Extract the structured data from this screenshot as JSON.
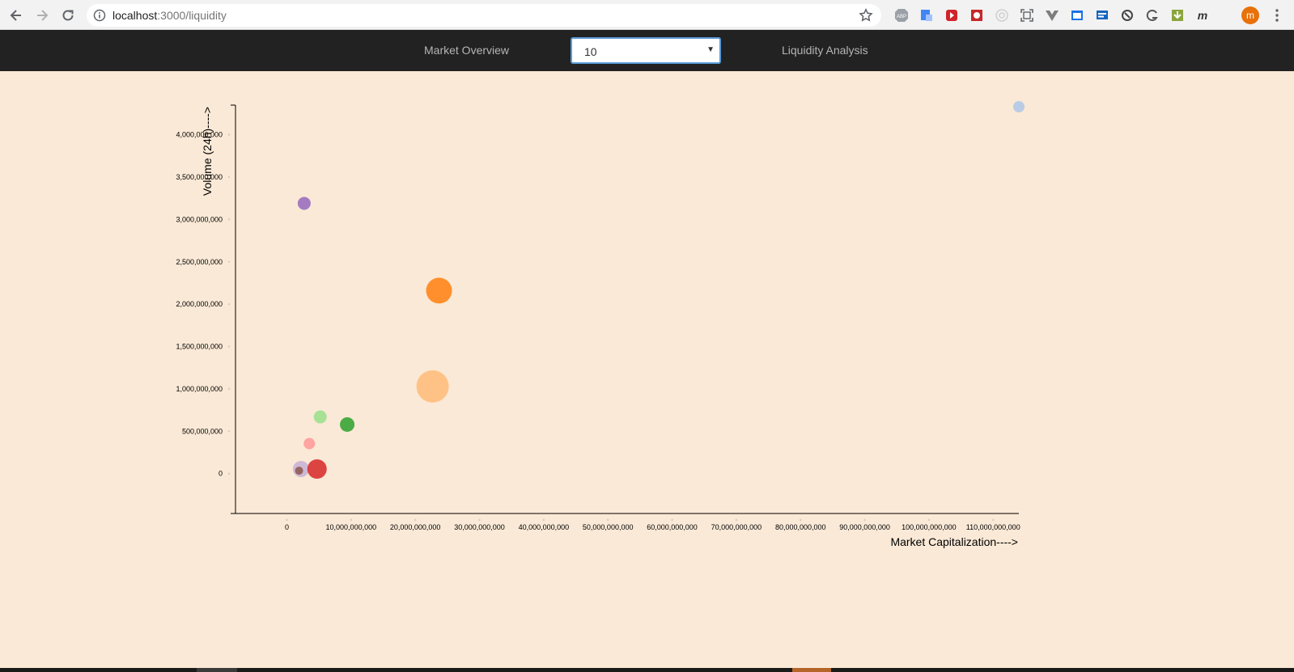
{
  "browser": {
    "url_host": "localhost",
    "url_path": ":3000/liquidity",
    "avatar_letter": "m"
  },
  "nav": {
    "market_overview": "Market Overview",
    "liquidity_analysis": "Liquidity Analysis",
    "select_value": "10"
  },
  "chart_data": {
    "type": "scatter",
    "title": "",
    "xlabel": "Market Capitalization---->",
    "ylabel": "Volume (24h)---->",
    "xlim": [
      -8000000000,
      114000000000
    ],
    "ylim": [
      -470000000,
      4330000000
    ],
    "x_ticks": [
      0,
      10000000000,
      20000000000,
      30000000000,
      40000000000,
      50000000000,
      60000000000,
      70000000000,
      80000000000,
      90000000000,
      100000000000,
      110000000000
    ],
    "x_tick_labels": [
      "0",
      "10,000,000,000",
      "20,000,000,000",
      "30,000,000,000",
      "40,000,000,000",
      "50,000,000,000",
      "60,000,000,000",
      "70,000,000,000",
      "80,000,000,000",
      "90,000,000,000",
      "100,000,000,000",
      "110,000,000,000"
    ],
    "y_ticks": [
      0,
      500000000,
      1000000000,
      1500000000,
      2000000000,
      2500000000,
      3000000000,
      3500000000,
      4000000000
    ],
    "y_tick_labels": [
      "0",
      "500,000,000",
      "1,000,000,000",
      "1,500,000,000",
      "2,000,000,000",
      "2,500,000,000",
      "3,000,000,000",
      "3,500,000,000",
      "4,000,000,000"
    ],
    "grid": false,
    "points": [
      {
        "x": 114000000000,
        "y": 4330000000,
        "r": 7,
        "color": "#aec7e8"
      },
      {
        "x": 2700000000,
        "y": 3190000000,
        "r": 8,
        "color": "#9467bd"
      },
      {
        "x": 23700000000,
        "y": 2160000000,
        "r": 16,
        "color": "#ff7f0e"
      },
      {
        "x": 22700000000,
        "y": 1030000000,
        "r": 20,
        "color": "#ffbb78"
      },
      {
        "x": 5200000000,
        "y": 670000000,
        "r": 8,
        "color": "#98df8a"
      },
      {
        "x": 9400000000,
        "y": 580000000,
        "r": 9,
        "color": "#2ca02c"
      },
      {
        "x": 3500000000,
        "y": 355000000,
        "r": 7,
        "color": "#ff9896"
      },
      {
        "x": 2200000000,
        "y": 55000000,
        "r": 10,
        "color": "#c5b0d5"
      },
      {
        "x": 4700000000,
        "y": 55000000,
        "r": 12,
        "color": "#d62728"
      },
      {
        "x": 1900000000,
        "y": 35000000,
        "r": 5,
        "color": "#8c564b"
      }
    ]
  }
}
